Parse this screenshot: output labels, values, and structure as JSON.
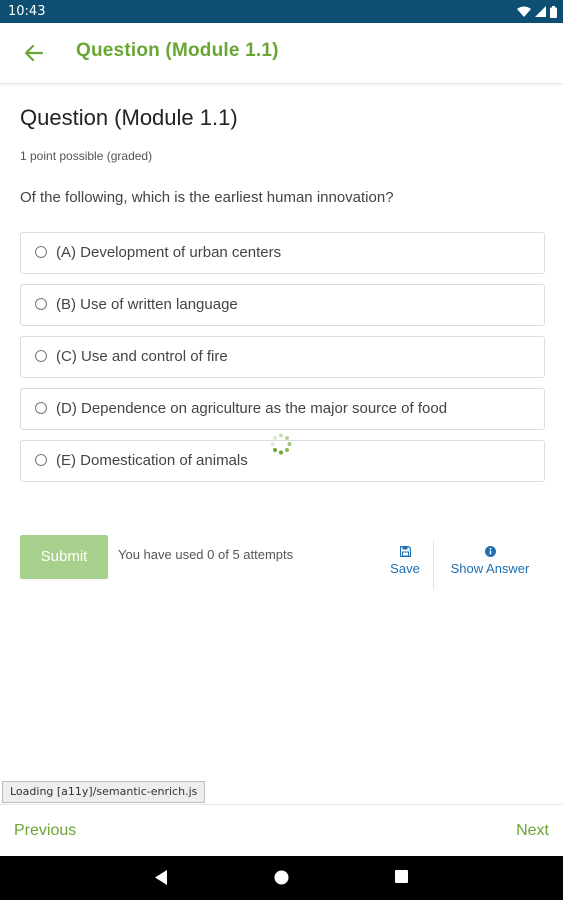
{
  "status_bar": {
    "time": "10:43"
  },
  "app_bar": {
    "title": "Question (Module 1.1)"
  },
  "question": {
    "heading": "Question (Module 1.1)",
    "points": "1 point possible (graded)",
    "prompt": "Of the following, which is the earliest human innovation?",
    "options": [
      "(A) Development of urban centers",
      "(B) Use of written language",
      "(C) Use and control of fire",
      "(D) Dependence on agriculture as the major source of food",
      "(E) Domestication of animals"
    ]
  },
  "actions": {
    "submit_label": "Submit",
    "attempts_text": "You have used 0 of 5 attempts",
    "save_label": "Save",
    "show_answer_label": "Show Answer"
  },
  "loading_text": "Loading [a11y]/semantic-enrich.js",
  "bottom_nav": {
    "previous_label": "Previous",
    "next_label": "Next"
  },
  "colors": {
    "status_bar": "#0c4f73",
    "accent_green": "#6aa633",
    "submit_disabled": "#a8d08d",
    "link_blue": "#1f6fb2"
  },
  "icons": {
    "back": "arrow-left-icon",
    "save": "floppy-disk-icon",
    "show_answer": "info-circle-icon",
    "loading": "spinner-icon"
  }
}
